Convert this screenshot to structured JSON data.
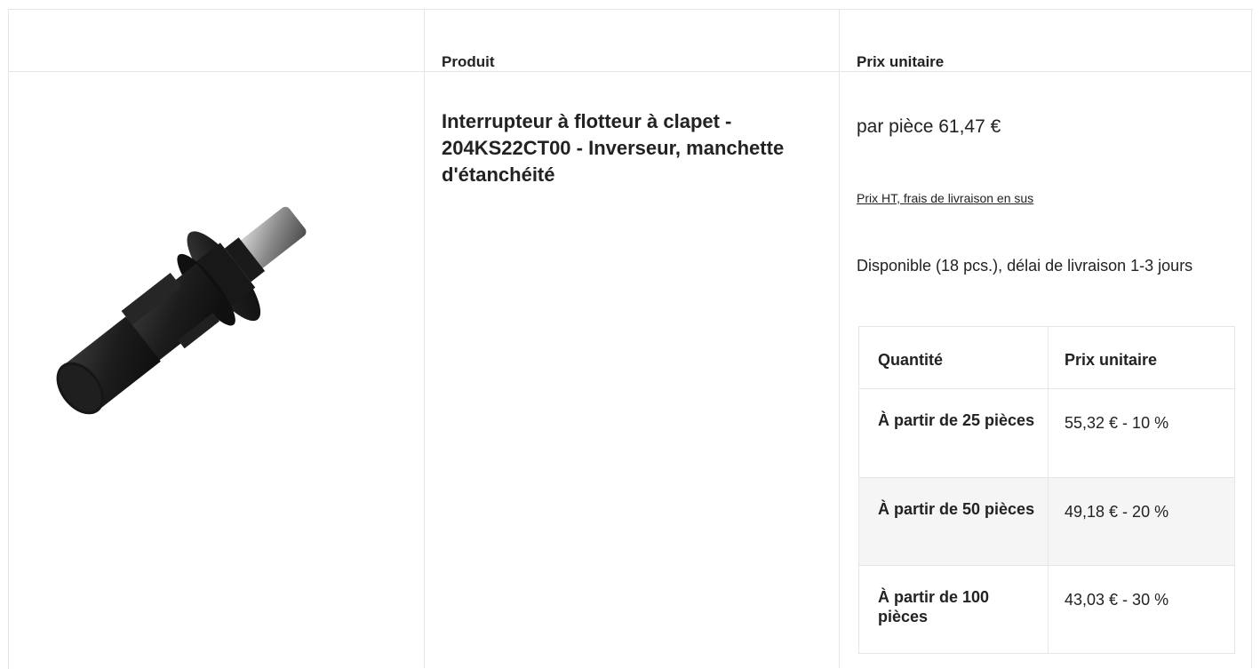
{
  "header": {
    "col_product": "Produit",
    "col_unit_price": "Prix unitaire"
  },
  "product": {
    "name": "Interrupteur à flotteur à clapet - 204KS22CT00 - Inverseur, manchette d'étanchéité",
    "image_icon": "float-switch-product-image",
    "price": "par pièce 61,47 €",
    "price_note": "Prix HT, frais de livraison en sus",
    "availability": "Disponible (18 pcs.), délai de livraison 1-3 jours"
  },
  "tiers": {
    "col_quantity": "Quantité",
    "col_unit_price": "Prix unitaire",
    "rows": [
      {
        "quantity": "À partir de 25 pièces",
        "price": "55,32 € - 10 %"
      },
      {
        "quantity": "À partir de 50 pièces",
        "price": "49,18 € - 20 %"
      },
      {
        "quantity": "À partir de 100 pièces",
        "price": "43,03 € - 30 %"
      }
    ]
  },
  "colors": {
    "border": "#e6e6e6",
    "alt_row": "#f5f5f5",
    "text": "#222222"
  }
}
